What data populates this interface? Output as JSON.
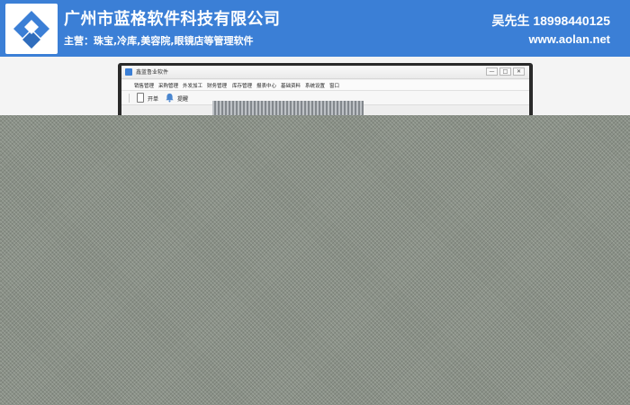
{
  "banner": {
    "company_name": "广州市蓝格软件科技有限公司",
    "business": "主营：珠宝,冷库,美容院,眼镜店等管理软件",
    "contact": "吴先生 18998440125",
    "website": "www.aolan.net",
    "accent_color": "#3b7fd6"
  },
  "app_window": {
    "title": "鑫蓝鲁业软件",
    "controls": [
      "—",
      "□",
      "✕"
    ],
    "menu": [
      "销售管理",
      "采购管理",
      "外发加工",
      "财务管理",
      "库存管理",
      "报表中心",
      "基础资料",
      "系统设置",
      "窗口"
    ],
    "toolbar": {
      "open_label": "开单",
      "remind_label": "提醒"
    }
  }
}
